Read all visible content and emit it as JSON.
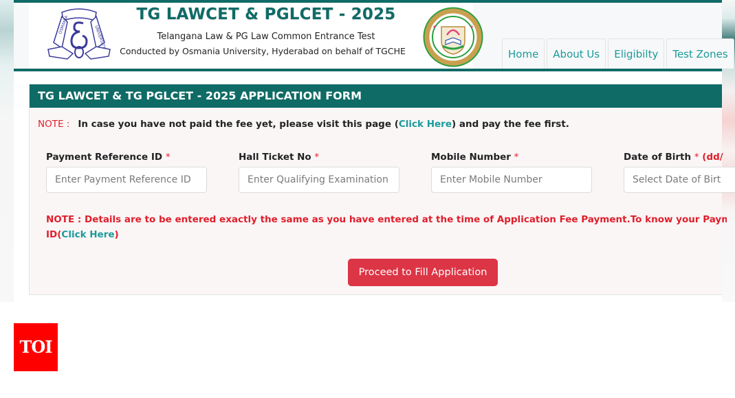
{
  "header": {
    "title": "TG LAWCET & PGLCET - 2025",
    "subtitle": "Telangana Law & PG Law Common Entrance Test",
    "conducted_by": "Conducted by Osmania University, Hyderabad on behalf of TGCHE",
    "logos": {
      "left": "osmania-university-emblem",
      "right": "telangana-council-of-higher-education-emblem"
    }
  },
  "nav": {
    "items": [
      {
        "label": "Home"
      },
      {
        "label": "About Us"
      },
      {
        "label": "Eligibilty"
      },
      {
        "label": "Test Zones"
      }
    ]
  },
  "form": {
    "heading": "TG LAWCET & TG PGLCET - 2025 APPLICATION FORM",
    "note_top": {
      "label": "NOTE :",
      "text_before": "In case you have not paid the fee yet, please visit this page (",
      "link": "Click Here",
      "text_after": ") and pay the fee first."
    },
    "fields": [
      {
        "label": "Payment Reference ID",
        "required": "*",
        "hint": "",
        "placeholder": "Enter Payment Reference ID",
        "value": ""
      },
      {
        "label": "Hall Ticket No",
        "required": "*",
        "hint": "",
        "placeholder": "Enter Qualifying Examination",
        "value": ""
      },
      {
        "label": "Mobile Number",
        "required": "*",
        "hint": "",
        "placeholder": "Enter Mobile Number",
        "value": ""
      },
      {
        "label": "Date of Birth",
        "required": "*",
        "hint": "(dd/",
        "placeholder": "Select Date of Birt",
        "value": ""
      }
    ],
    "note_bottom": {
      "line1": "NOTE : Details are to be entered exactly the same as you have entered at the time of Application Fee Payment.To know your Payment Referer",
      "line2_prefix": "ID(",
      "link": "Click Here",
      "line2_suffix": ")"
    },
    "submit_label": "Proceed to Fill Application"
  },
  "watermark": {
    "label": "TOI"
  },
  "colors": {
    "brand_teal": "#0f6b66",
    "link_teal": "#1a9a9a",
    "alert_red": "#e01e2b",
    "button_red": "#dc3545",
    "toi_red": "#ff0000"
  }
}
